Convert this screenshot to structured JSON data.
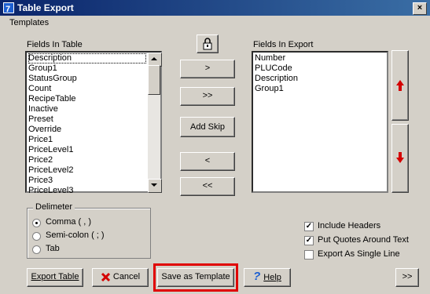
{
  "window": {
    "title": "Table Export",
    "close_label": "×"
  },
  "menu": {
    "templates": "Templates"
  },
  "fields_in_table": {
    "label": "Fields In Table",
    "items": [
      "Description",
      "Group1",
      "StatusGroup",
      "Count",
      "RecipeTable",
      "Inactive",
      "Preset",
      "Override",
      "Price1",
      "PriceLevel1",
      "Price2",
      "PriceLevel2",
      "Price3",
      "PriceLevel3"
    ]
  },
  "fields_in_export": {
    "label": "Fields In Export",
    "items": [
      "Number",
      "PLUCode",
      "Description",
      "Group1"
    ]
  },
  "center_buttons": {
    "add_one": ">",
    "add_all": ">>",
    "add_skip": "Add Skip",
    "remove_one": "<",
    "remove_all": "<<"
  },
  "delimeter": {
    "label": "Delimeter",
    "options": [
      "Comma ( , )",
      "Semi-colon ( ; )",
      "Tab"
    ],
    "selected": "Comma ( , )"
  },
  "options": {
    "include_headers": "Include Headers",
    "put_quotes": "Put Quotes Around Text",
    "single_line": "Export As Single Line",
    "include_headers_checked": true,
    "put_quotes_checked": true,
    "single_line_checked": false
  },
  "bottom_buttons": {
    "export_table": "Export Table",
    "cancel": "Cancel",
    "save_template": "Save as Template",
    "help": "Help",
    "more": ">>"
  },
  "colors": {
    "title_start": "#0a246a",
    "title_end": "#3a6ea5",
    "arrow_red": "#d40000",
    "highlight": "#e00000"
  }
}
